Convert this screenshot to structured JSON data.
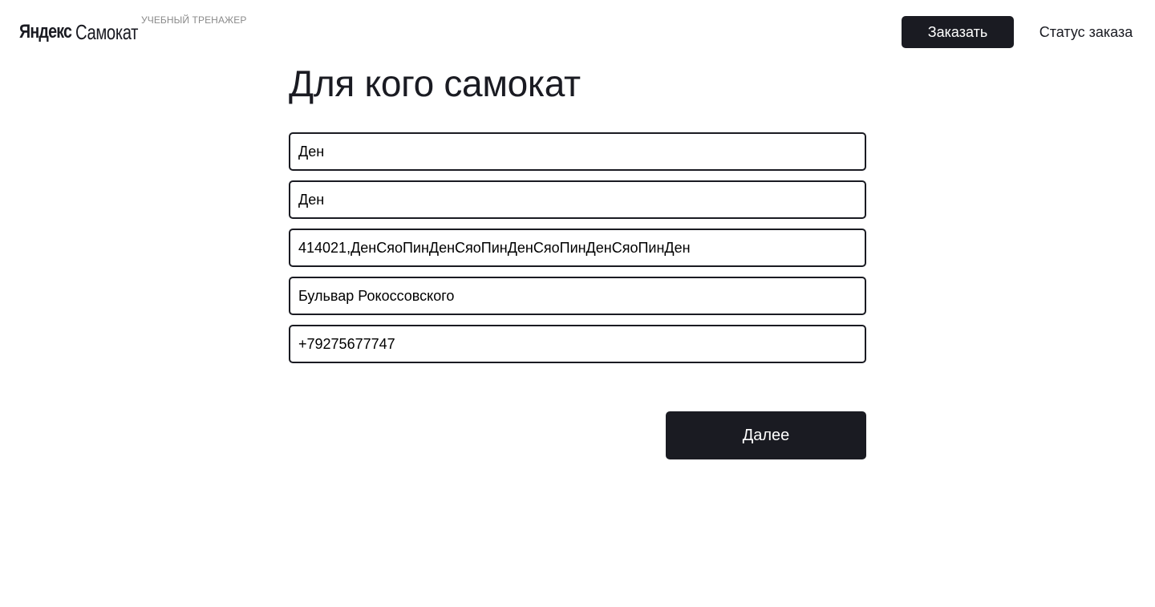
{
  "header": {
    "logo_yandex": "Яндекс",
    "logo_samokat": "Самокат",
    "logo_subtitle": "УЧЕБНЫЙ ТРЕНАЖЕР",
    "order_button": "Заказать",
    "status_button": "Статус заказа"
  },
  "main": {
    "title": "Для кого самокат",
    "fields": {
      "first_name": "Ден",
      "last_name": "Ден",
      "address": "414021,ДенСяоПинДенСяоПинДенСяоПинДенСяоПинДен",
      "metro_station": "Бульвар Рокоссовского",
      "phone": "+79275677747"
    },
    "next_button": "Далее"
  },
  "colors": {
    "primary_dark": "#1a1b22",
    "background": "#ffffff",
    "subtitle_gray": "#8a8a8a"
  }
}
